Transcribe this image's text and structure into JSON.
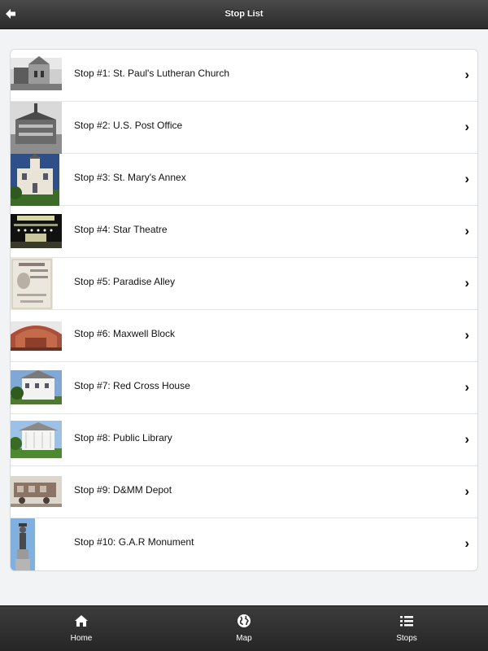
{
  "header": {
    "title": "Stop List",
    "back_icon": "back-arrow-icon"
  },
  "stops": [
    {
      "label": "Stop #1: St. Paul's Lutheran Church"
    },
    {
      "label": "Stop #2: U.S. Post Office"
    },
    {
      "label": "Stop #3: St. Mary's Annex"
    },
    {
      "label": "Stop #4: Star Theatre"
    },
    {
      "label": "Stop #5: Paradise Alley"
    },
    {
      "label": "Stop #6: Maxwell Block"
    },
    {
      "label": "Stop #7: Red Cross House"
    },
    {
      "label": "Stop #8: Public Library"
    },
    {
      "label": "Stop #9: D&MM Depot"
    },
    {
      "label": "Stop #10: G.A.R Monument"
    }
  ],
  "tabs": [
    {
      "label": "Home",
      "icon": "home-icon"
    },
    {
      "label": "Map",
      "icon": "globe-icon"
    },
    {
      "label": "Stops",
      "icon": "list-icon"
    }
  ],
  "chevron": "›",
  "colors": {
    "header": "#2b2b2b",
    "footer": "#262626",
    "background": "#f1f3f5"
  }
}
